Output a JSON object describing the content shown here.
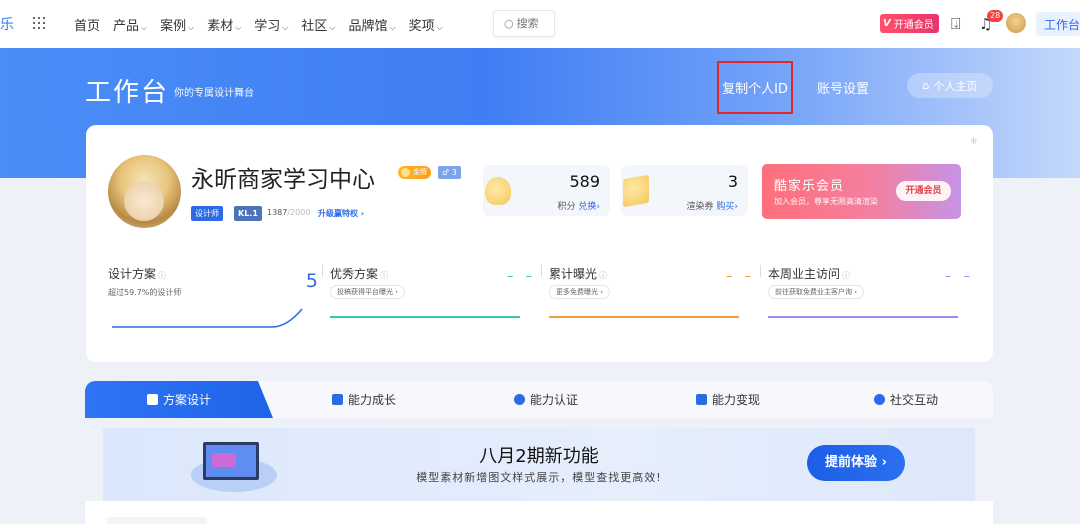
{
  "nav": {
    "logo_fragment": "乐",
    "items": [
      "首页",
      "产品",
      "案例",
      "素材",
      "学习",
      "社区",
      "品牌馆",
      "奖项"
    ],
    "search_placeholder": "搜索",
    "vip_label": "开通会员",
    "notification_count": "28",
    "workbench_label": "工作台"
  },
  "hero": {
    "title": "工作台",
    "subtitle": "你的专属设计舞台",
    "copy_id": "复制个人ID",
    "account": "账号设置",
    "home": "个人主页"
  },
  "profile": {
    "name": "永昕商家学习中心",
    "gold_badge": "金牌",
    "level_badge": "3",
    "role": "设计师",
    "kl": "KL.1",
    "kl_points": "1387",
    "kl_max": "/2000",
    "kl_upgrade": "升级赢特权 ›"
  },
  "stats": [
    {
      "value": "589",
      "label": "积分",
      "link": "兑换›"
    },
    {
      "value": "3",
      "label": "渲染券",
      "link": "购买›"
    }
  ],
  "vip_card": {
    "title": "酷家乐会员",
    "subtitle": "加入会员，尊享无限高清渲染",
    "button": "开通会员"
  },
  "metrics": [
    {
      "title": "设计方案",
      "sub": "超过59.7%的设计师",
      "value": "5",
      "color": "#2d6be5"
    },
    {
      "title": "优秀方案",
      "pill": "投稿获得平台曝光 ›",
      "value": "– –",
      "color": "#39c8b4"
    },
    {
      "title": "累计曝光",
      "pill": "更多免费曝光 ›",
      "value": "– –",
      "color": "#f39a3b"
    },
    {
      "title": "本周业主访问",
      "pill": "前往获取免费业主客户询 ›",
      "value": "– –",
      "color": "#9b8cf0"
    }
  ],
  "tabs": [
    "方案设计",
    "能力成长",
    "能力认证",
    "能力变现",
    "社交互动"
  ],
  "feature": {
    "title": "八月2期新功能",
    "subtitle": "模型素材新增图文样式展示，模型查找更高效!",
    "button": "提前体验 ›"
  }
}
